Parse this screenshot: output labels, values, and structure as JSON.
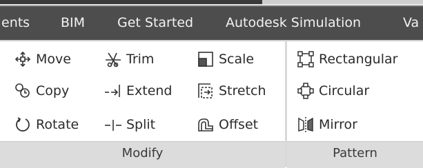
{
  "tabs": [
    {
      "label": "ents"
    },
    {
      "label": "BIM"
    },
    {
      "label": "Get Started"
    },
    {
      "label": "Autodesk Simulation"
    },
    {
      "label": "Va"
    }
  ],
  "modify_panel": {
    "title": "Modify",
    "tools": [
      {
        "label": "Move",
        "icon": "move-icon"
      },
      {
        "label": "Copy",
        "icon": "copy-icon"
      },
      {
        "label": "Rotate",
        "icon": "rotate-icon"
      },
      {
        "label": "Trim",
        "icon": "trim-icon"
      },
      {
        "label": "Extend",
        "icon": "extend-icon"
      },
      {
        "label": "Split",
        "icon": "split-icon"
      },
      {
        "label": "Scale",
        "icon": "scale-icon"
      },
      {
        "label": "Stretch",
        "icon": "stretch-icon"
      },
      {
        "label": "Offset",
        "icon": "offset-icon"
      }
    ]
  },
  "pattern_panel": {
    "title": "Pattern",
    "tools": [
      {
        "label": "Rectangular",
        "icon": "rectangular-pattern-icon"
      },
      {
        "label": "Circular",
        "icon": "circular-pattern-icon"
      },
      {
        "label": "Mirror",
        "icon": "mirror-icon"
      }
    ]
  }
}
